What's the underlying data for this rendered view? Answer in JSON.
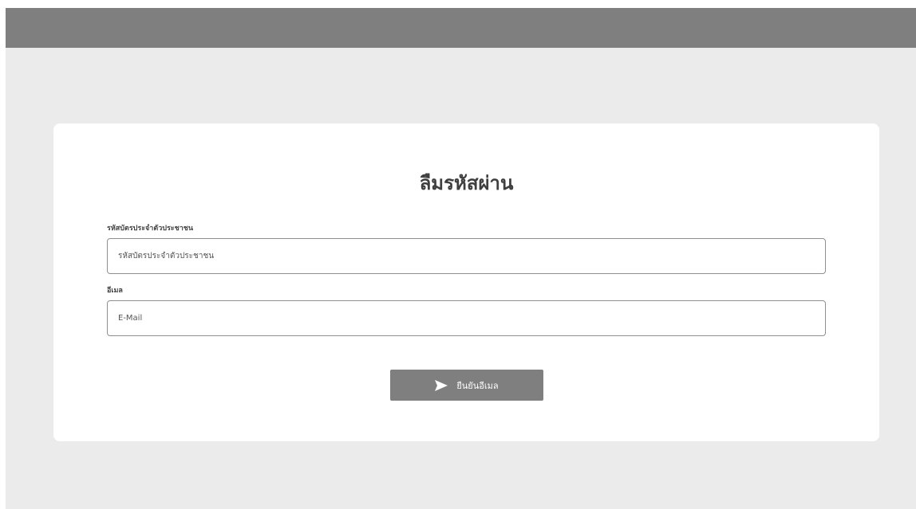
{
  "form": {
    "title": "ลืมรหัสผ่าน",
    "national_id": {
      "label": "รหัสบัตรประจำตัวประชาชน",
      "placeholder": "รหัสบัตรประจำตัวประชาชน",
      "value": ""
    },
    "email": {
      "label": "อีเมล",
      "placeholder": "E-Mail",
      "value": ""
    },
    "submit": {
      "label": "ยืนยันอีเมล",
      "icon": "send-icon"
    }
  },
  "colors": {
    "topbar": "#7f7f7f",
    "background": "#ebebeb",
    "card": "#ffffff",
    "button": "#7f7f7f",
    "button_text": "#ffffff"
  }
}
